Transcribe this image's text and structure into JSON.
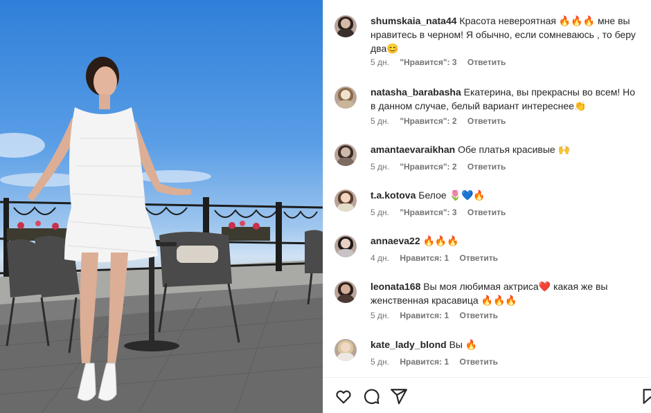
{
  "post": {
    "photo_alt": "photo",
    "colors": {
      "sky": "#3b86dc",
      "dress": "#f4f4f4",
      "railing": "#222222",
      "floor": "#6f6f6f"
    }
  },
  "comments": [
    {
      "user": "shumskaia_nata44",
      "text": "Красота невероятная 🔥🔥🔥 мне вы нравитесь в черном! Я обычно, если сомневаюсь , то беру два😊",
      "time": "5 дн.",
      "likes": "\"Нравится\": 3",
      "reply": "Ответить",
      "avatar_colors": [
        "#3a2e2a",
        "#2b2220",
        "#d8b9a5"
      ]
    },
    {
      "user": "natasha_barabasha",
      "text": "Екатерина, вы прекрасны во всем! Но в данном случае, белый вариант интереснее👏",
      "time": "5 дн.",
      "likes": "\"Нравится\": 2",
      "reply": "Ответить",
      "avatar_colors": [
        "#c9b59a",
        "#8a6a48",
        "#f0e2d0"
      ]
    },
    {
      "user": "amantaevaraikhan",
      "text": "Обе платья красивые 🙌",
      "time": "5 дн.",
      "likes": "\"Нравится\": 2",
      "reply": "Ответить",
      "avatar_colors": [
        "#7d6b62",
        "#3b2c26",
        "#cdb8aa"
      ]
    },
    {
      "user": "t.a.kotova",
      "text": "Белое 🌷💙🔥",
      "time": "5 дн.",
      "likes": "\"Нравится\": 3",
      "reply": "Ответить",
      "avatar_colors": [
        "#e3dcc8",
        "#5a3d2b",
        "#f2d6c0"
      ]
    },
    {
      "user": "annaeva22",
      "text": "🔥🔥🔥",
      "time": "4 дн.",
      "likes": "Нравится: 1",
      "reply": "Ответить",
      "avatar_colors": [
        "#c8c2c4",
        "#1f1a1a",
        "#e8d1c3"
      ]
    },
    {
      "user": "leonata168",
      "text": "Вы моя любимая актриса❤️ какая же вы женственная красавица 🔥🔥🔥",
      "time": "5 дн.",
      "likes": "Нравится: 1",
      "reply": "Ответить",
      "avatar_colors": [
        "#4a3a33",
        "#2a1d18",
        "#d3ad95"
      ]
    },
    {
      "user": "kate_lady_blond",
      "text": "Вы 🔥",
      "time": "5 дн.",
      "likes": "Нравится: 1",
      "reply": "Ответить",
      "avatar_colors": [
        "#ede8e3",
        "#d8c79d",
        "#f1d8c6"
      ]
    }
  ],
  "actions": [
    {
      "name": "like",
      "icon": "heart-icon"
    },
    {
      "name": "comment",
      "icon": "comment-icon"
    },
    {
      "name": "share",
      "icon": "share-icon"
    },
    {
      "name": "save",
      "icon": "bookmark-icon"
    }
  ]
}
